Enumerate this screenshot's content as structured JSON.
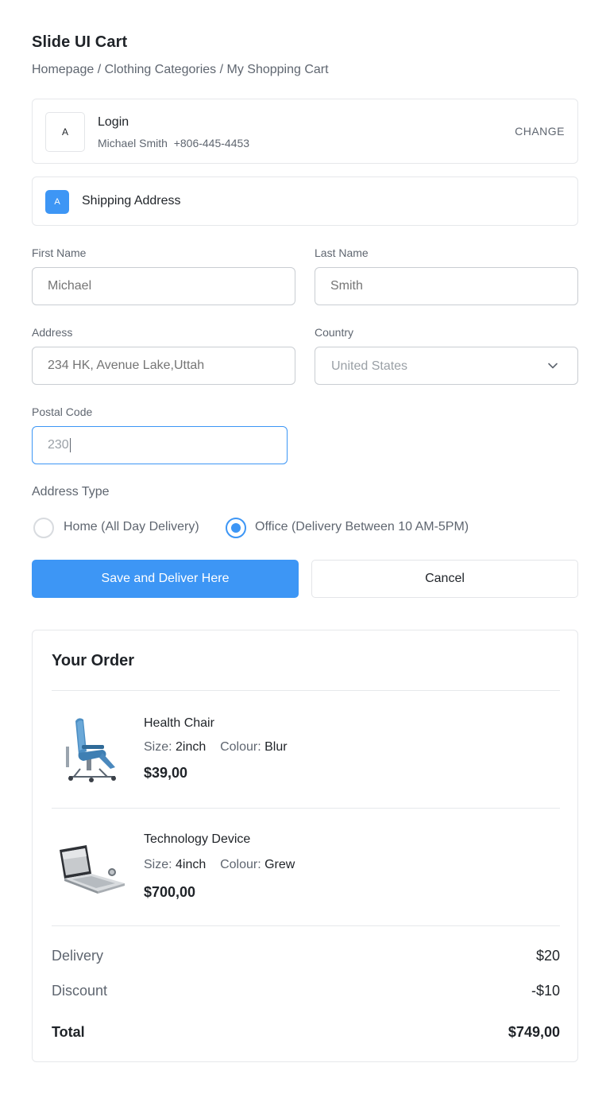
{
  "app": {
    "title": "Slide UI Cart"
  },
  "breadcrumb": [
    "Homepage",
    "Clothing Categories",
    "My Shopping Cart"
  ],
  "login": {
    "badge": "A",
    "title": "Login",
    "name": "Michael Smith",
    "phone": "+806-445-4453",
    "action": "CHANGE"
  },
  "shipping": {
    "badge": "A",
    "title": "Shipping Address"
  },
  "form": {
    "first_name": {
      "label": "First Name",
      "placeholder": "Michael"
    },
    "last_name": {
      "label": "Last Name",
      "placeholder": "Smith"
    },
    "address": {
      "label": "Address",
      "placeholder": "234 HK, Avenue Lake,Uttah"
    },
    "country": {
      "label": "Country",
      "value": "United States"
    },
    "postal_code": {
      "label": "Postal Code",
      "value": "230"
    },
    "address_type": {
      "label": "Address Type",
      "options": [
        {
          "label": "Home (All Day Delivery)",
          "selected": false
        },
        {
          "label": "Office (Delivery Between 10 AM-5PM)",
          "selected": true
        }
      ]
    },
    "save_label": "Save and Deliver Here",
    "cancel_label": "Cancel"
  },
  "order": {
    "title": "Your Order",
    "items": [
      {
        "name": "Health Chair",
        "size_label": "Size:",
        "size": "2inch",
        "colour_label": "Colour:",
        "colour": "Blur",
        "price": "$39,00",
        "icon": "chair-image"
      },
      {
        "name": "Technology Device",
        "size_label": "Size:",
        "size": "4inch",
        "colour_label": "Colour:",
        "colour": "Grew",
        "price": "$700,00",
        "icon": "laptop-image"
      }
    ],
    "summary": {
      "delivery_label": "Delivery",
      "delivery": "$20",
      "discount_label": "Discount",
      "discount": "-$10",
      "total_label": "Total",
      "total": "$749,00"
    }
  },
  "colors": {
    "accent": "#3d96f5",
    "border": "#e6e8eb",
    "text": "#1f2328",
    "muted": "#5f6670"
  }
}
